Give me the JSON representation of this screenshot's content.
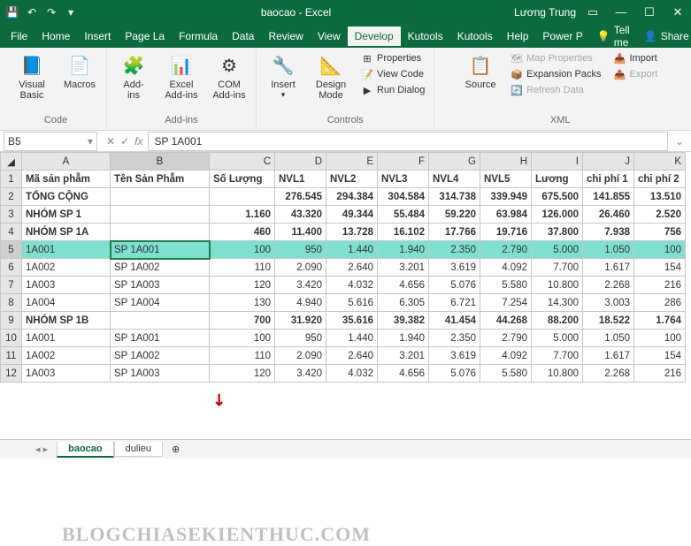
{
  "titlebar": {
    "doc": "baocao - Excel",
    "user": "Lương Trung"
  },
  "tabs": [
    "File",
    "Home",
    "Insert",
    "Page La",
    "Formula",
    "Data",
    "Review",
    "View",
    "Develop",
    "Kutools",
    "Kutools",
    "Help",
    "Power P"
  ],
  "active_tab": "Develop",
  "tell_me": "Tell me",
  "share": "Share",
  "ribbon": {
    "code": {
      "label": "Code",
      "visual_basic": "Visual\nBasic",
      "macros": "Macros"
    },
    "addins": {
      "label": "Add-ins",
      "addins_btn": "Add-\nins",
      "excel": "Excel\nAdd-ins",
      "com": "COM\nAdd-ins"
    },
    "controls": {
      "label": "Controls",
      "insert": "Insert",
      "design": "Design\nMode",
      "props": "Properties",
      "view_code": "View Code",
      "run": "Run Dialog"
    },
    "xml": {
      "label": "XML",
      "source": "Source",
      "map_props": "Map Properties",
      "expansion": "Expansion Packs",
      "refresh": "Refresh Data",
      "import": "Import",
      "export": "Export"
    }
  },
  "namebox": "B5",
  "fx_value": "SP 1A001",
  "cols": [
    "A",
    "B",
    "C",
    "D",
    "E",
    "F",
    "G",
    "H",
    "I",
    "J",
    "K"
  ],
  "headers": [
    "Mã sản phẫm",
    "Tên Sản Phẫm",
    "Số Lượng",
    "NVL1",
    "NVL2",
    "NVL3",
    "NVL4",
    "NVL5",
    "Lương",
    "chi phí 1",
    "chi phí 2"
  ],
  "rows": [
    {
      "n": 2,
      "c": [
        "TỔNG CỘNG",
        "",
        "",
        "276.545",
        "294.384",
        "304.584",
        "314.738",
        "339.949",
        "675.500",
        "141.855",
        "13.510"
      ],
      "b": true
    },
    {
      "n": 3,
      "c": [
        "NHÓM SP 1",
        "",
        "1.160",
        "43.320",
        "49.344",
        "55.484",
        "59.220",
        "63.984",
        "126.000",
        "26.460",
        "2.520"
      ],
      "b": true
    },
    {
      "n": 4,
      "c": [
        "NHÓM SP 1A",
        "",
        "460",
        "11.400",
        "13.728",
        "16.102",
        "17.766",
        "19.716",
        "37.800",
        "7.938",
        "756"
      ],
      "b": true
    },
    {
      "n": 5,
      "c": [
        "1A001",
        "SP 1A001",
        "100",
        "950",
        "1.440",
        "1.940",
        "2.350",
        "2.790",
        "5.000",
        "1.050",
        "100"
      ],
      "hl": true
    },
    {
      "n": 6,
      "c": [
        "1A002",
        "SP 1A002",
        "110",
        "2.090",
        "2.640",
        "3.201",
        "3.619",
        "4.092",
        "7.700",
        "1.617",
        "154"
      ]
    },
    {
      "n": 7,
      "c": [
        "1A003",
        "SP 1A003",
        "120",
        "3.420",
        "4.032",
        "4.656",
        "5.076",
        "5.580",
        "10.800",
        "2.268",
        "216"
      ]
    },
    {
      "n": 8,
      "c": [
        "1A004",
        "SP 1A004",
        "130",
        "4.940",
        "5.616",
        "6.305",
        "6.721",
        "7.254",
        "14.300",
        "3.003",
        "286"
      ]
    },
    {
      "n": 9,
      "c": [
        "NHÓM SP 1B",
        "",
        "700",
        "31.920",
        "35.616",
        "39.382",
        "41.454",
        "44.268",
        "88.200",
        "18.522",
        "1.764"
      ],
      "b": true
    },
    {
      "n": 10,
      "c": [
        "1A001",
        "SP 1A001",
        "100",
        "950",
        "1.440",
        "1.940",
        "2.350",
        "2.790",
        "5.000",
        "1.050",
        "100"
      ]
    },
    {
      "n": 11,
      "c": [
        "1A002",
        "SP 1A002",
        "110",
        "2.090",
        "2.640",
        "3.201",
        "3.619",
        "4.092",
        "7.700",
        "1.617",
        "154"
      ]
    },
    {
      "n": 12,
      "c": [
        "1A003",
        "SP 1A003",
        "120",
        "3.420",
        "4.032",
        "4.656",
        "5.076",
        "5.580",
        "10.800",
        "2.268",
        "216"
      ]
    }
  ],
  "sheets": {
    "active": "baocao",
    "other": "dulieu"
  }
}
